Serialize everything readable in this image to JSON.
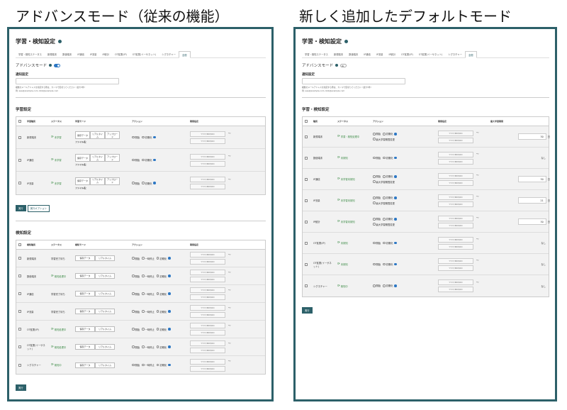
{
  "captions": {
    "left": "アドバンスモード（従来の機能）",
    "right": "新しく追加したデフォルトモード"
  },
  "panel": {
    "title": "学習・検知設定",
    "tabs_left": [
      "学習・検知ステータス",
      "新規端末",
      "数値端末",
      "IP通信",
      "IP流量",
      "IP統計",
      "OT鉱業(IP)",
      "OT鉱業(イーサネット)",
      "シグネチャー",
      "全般"
    ],
    "tabs_right": [
      "学習・検知ステータス",
      "新規端末",
      "数値端末",
      "IP通信",
      "IP流量",
      "IP統計",
      "OT鉱業(IP)",
      "OT鉱業(イーサネット)",
      "シグネチャー",
      "全般"
    ],
    "advanced_label": "アドバンスモード",
    "notify_label": "通知設定",
    "notify_help": "複数のメールアドレスを指定する際は、カンマで区切ってください（最大5件）",
    "notify_example": "例: aaa@example.com, bbb@example.com",
    "learn_section": "学習設定",
    "detect_section": "検知設定",
    "learn_detect_section": "学習・検知設定",
    "run_button": "実行",
    "run_option_button": "実行オプション"
  },
  "common": {
    "date_placeholder": "YYYY/MM/DD",
    "tilde": "〜",
    "radio_open": "開始",
    "radio_init": "初期化",
    "radio_pause": "一時停止",
    "radio_change_period": "最大学習期間変更",
    "days_unit": "日",
    "none": "なし",
    "file_label": "ファイル名："
  },
  "learn_table": {
    "headers": [
      "",
      "学習種別",
      "ステータス",
      "学習モード",
      "アクション",
      "期間指定"
    ],
    "mode_buttons": [
      "保存データ",
      "リアルタイム",
      "アップロード"
    ],
    "rows": [
      {
        "type": "新規端末",
        "status": "未学習"
      },
      {
        "type": "IP通信",
        "status": "未学習"
      },
      {
        "type": "IP流量",
        "status": "未学習"
      }
    ]
  },
  "detect_table": {
    "headers": [
      "",
      "検知種別",
      "ステータス",
      "検知モード",
      "アクション",
      "期間指定"
    ],
    "mode_buttons": [
      "保存データ",
      "リアルタイム"
    ],
    "rows": [
      {
        "type": "新規端末",
        "status": "学習完了待ち",
        "kind": "wait"
      },
      {
        "type": "数値端末",
        "status": "検知処理中",
        "kind": "green"
      },
      {
        "type": "IP通信",
        "status": "学習完了待ち",
        "kind": "wait"
      },
      {
        "type": "IP流量",
        "status": "学習完了待ち",
        "kind": "wait"
      },
      {
        "type": "OT鉱業(IP)",
        "status": "検知処理中",
        "kind": "green"
      },
      {
        "type": "OT鉱業(イーサネット)",
        "status": "検知処理中",
        "kind": "green"
      },
      {
        "type": "シグネチャー",
        "status": "検知中",
        "kind": "green"
      }
    ]
  },
  "right_table": {
    "headers": [
      "",
      "種別",
      "ステータス",
      "アクション",
      "期間指定",
      "最大学習期間"
    ],
    "rows": [
      {
        "type": "新規端末",
        "status": "学習・検知処理中",
        "change": true,
        "days": "30"
      },
      {
        "type": "数値端末",
        "status": "未検知",
        "change": false,
        "days": ""
      },
      {
        "type": "IP通信",
        "status": "未学習未検知",
        "change": true,
        "days": "30"
      },
      {
        "type": "IP流量",
        "status": "未学習未検知",
        "change": true,
        "days": "21"
      },
      {
        "type": "IP統計",
        "status": "未学習未検知",
        "change": true,
        "days": "30"
      },
      {
        "type": "OT鉱業(IP)",
        "status": "未検知",
        "change": false,
        "days": ""
      },
      {
        "type": "OT鉱業(イーサネット)",
        "status": "未検知",
        "change": false,
        "days": ""
      },
      {
        "type": "シグネチャー",
        "status": "検知中",
        "change": false,
        "days": ""
      }
    ]
  }
}
